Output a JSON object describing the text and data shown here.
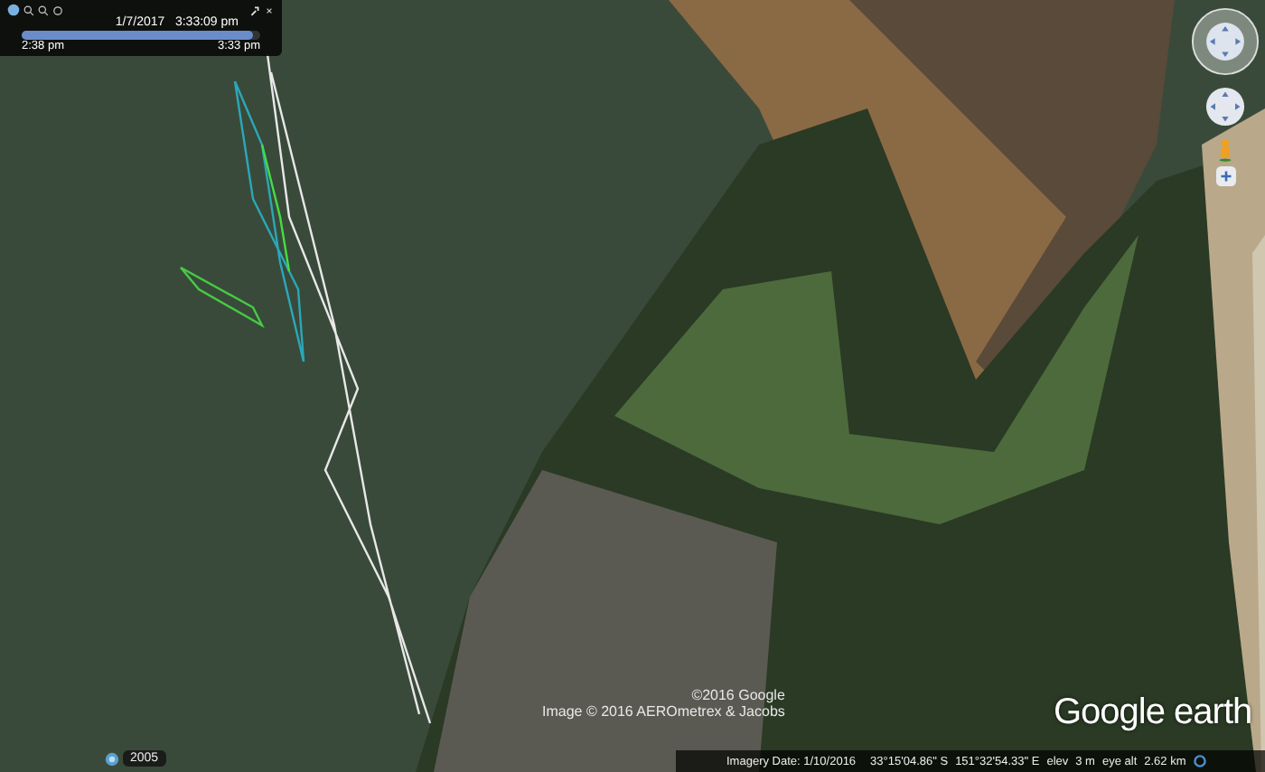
{
  "time_slider": {
    "date_time": "1/7/2017   3:33:09 pm",
    "start": "2:38 pm",
    "end": "3:33 pm",
    "level": 0.97
  },
  "map": {
    "copyright": "©2016 Google",
    "image_credit": "Image © 2016 AEROmetrex & Jacobs",
    "logo": "Google earth",
    "historical_year": "2005"
  },
  "status_bar": {
    "imagery_date": "Imagery Date: 1/10/2016",
    "latitude": "33°15'04.86\" S",
    "longitude": "151°32'54.33\" E",
    "elev_label": "elev",
    "elev": "3 m",
    "eye_alt_label": "eye alt",
    "eye_alt": "2.62 km"
  }
}
